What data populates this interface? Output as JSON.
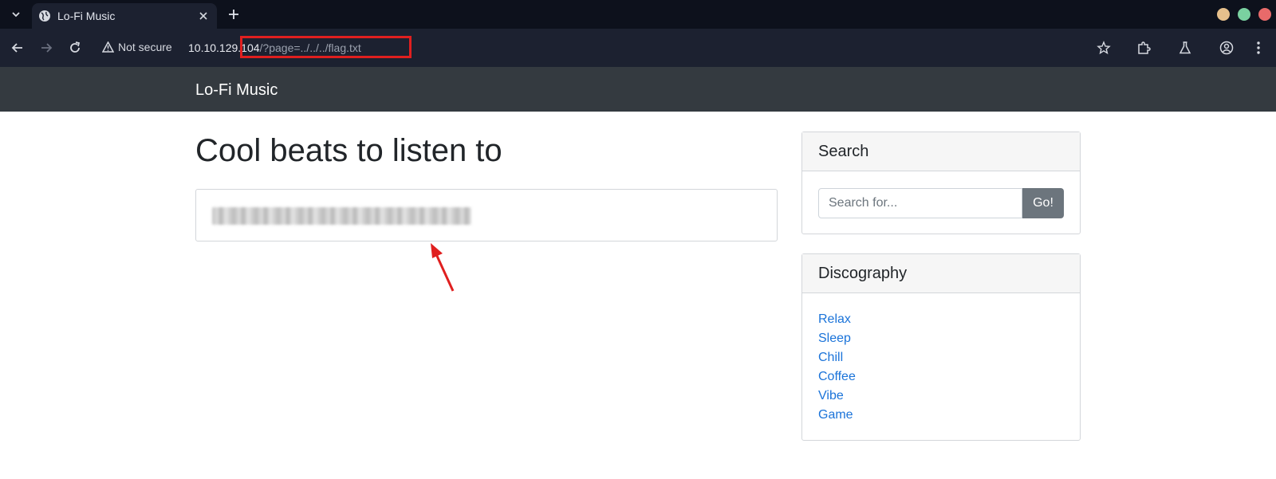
{
  "browser": {
    "tab_title": "Lo-Fi Music",
    "security_label": "Not secure",
    "url_host": "10.10.129.104",
    "url_path": "/?page=../../../flag.txt",
    "window_colors": {
      "minimize": "#e6c08c",
      "maximize": "#7ad1a0",
      "close": "#e86a6a"
    }
  },
  "site": {
    "brand": "Lo-Fi Music",
    "heading": "Cool beats to listen to",
    "search": {
      "title": "Search",
      "placeholder": "Search for...",
      "button": "Go!"
    },
    "discography": {
      "title": "Discography",
      "items": [
        "Relax",
        "Sleep",
        "Chill",
        "Coffee",
        "Vibe",
        "Game"
      ]
    }
  },
  "annotation": {
    "highlight_color": "#e01f1f",
    "arrow_color": "#e01f1f"
  }
}
